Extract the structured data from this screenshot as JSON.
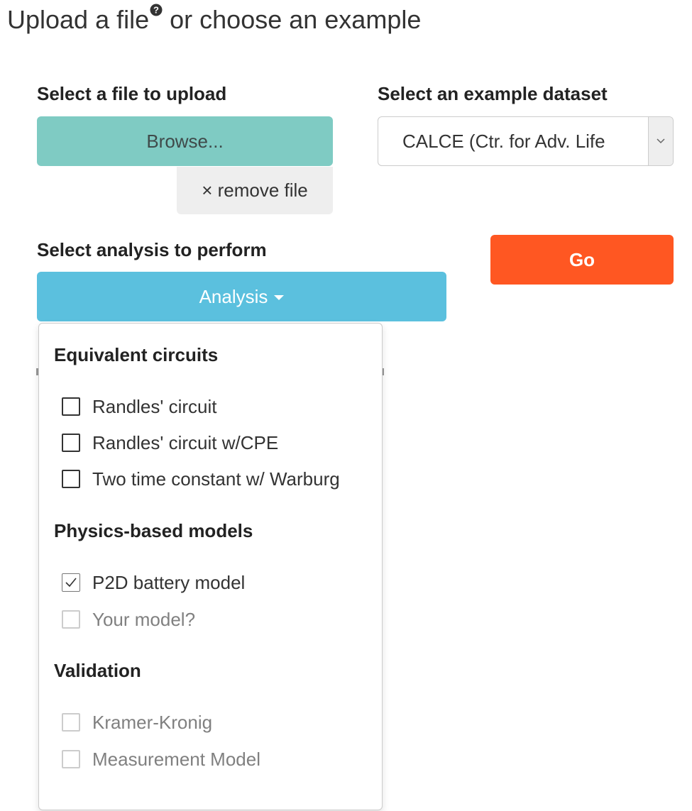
{
  "header": {
    "title_prefix": "Upload a file",
    "title_suffix": " or choose an example",
    "help_icon": "question-circle-icon"
  },
  "upload": {
    "label": "Select a file to upload",
    "browse_label": "Browse...",
    "remove_label": "× remove file"
  },
  "example": {
    "label": "Select an example dataset",
    "selected": "CALCE (Ctr. for Adv. Life",
    "arrow_icon": "chevron-down-icon"
  },
  "analysis": {
    "label": "Select analysis to perform",
    "button_label": "Analysis",
    "caret_icon": "caret-down-icon"
  },
  "go_label": "Go",
  "colors": {
    "browse": "#7fcbc3",
    "analysis": "#5bc0de",
    "go": "#ff5722"
  },
  "menu": {
    "groups": [
      {
        "header": "Equivalent circuits",
        "options": [
          {
            "label": "Randles' circuit",
            "checked": false,
            "disabled": false
          },
          {
            "label": "Randles' circuit w/CPE",
            "checked": false,
            "disabled": false
          },
          {
            "label": "Two time constant w/ Warburg",
            "checked": false,
            "disabled": false
          }
        ]
      },
      {
        "header": "Physics-based models",
        "options": [
          {
            "label": "P2D battery model",
            "checked": true,
            "disabled": false
          },
          {
            "label": "Your model?",
            "checked": false,
            "disabled": true
          }
        ]
      },
      {
        "header": "Validation",
        "options": [
          {
            "label": "Kramer-Kronig",
            "checked": false,
            "disabled": true
          },
          {
            "label": "Measurement Model",
            "checked": false,
            "disabled": true
          }
        ]
      }
    ]
  }
}
